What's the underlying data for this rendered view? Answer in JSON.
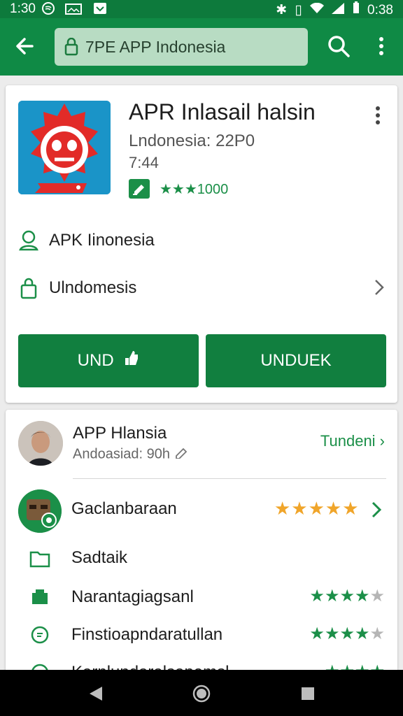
{
  "status_bar": {
    "time": "1:30",
    "right_time": "0:38",
    "icons": [
      "spotify-icon",
      "gallery-icon",
      "notification-icon"
    ]
  },
  "app_bar": {
    "search_text": "7PE  APP Indonesia"
  },
  "app": {
    "title": "APR Inlasail halsin",
    "subtitle": "Lndonesia: 22P0",
    "size": "7:44",
    "rating_text": "★★★1000"
  },
  "info_rows": [
    {
      "label": "APK Iinonesia"
    },
    {
      "label": "Ulndomesis"
    }
  ],
  "buttons": {
    "left": "UND",
    "right": "UNDUEK"
  },
  "developer": {
    "name": "APP Hlansia",
    "sub": "Andoasiad: 90h",
    "link": "Tundeni ›"
  },
  "game": {
    "name": "Gaclanbaraan",
    "stars": "★★★★★"
  },
  "list": [
    {
      "label": "Sadtaik",
      "stars": ""
    },
    {
      "label": "Narantagiagsanl",
      "stars": "★★★★"
    },
    {
      "label": "Finstioapndaratullan",
      "stars": "★★★★"
    },
    {
      "label": "Karnlundaralsapemsl",
      "stars": "★★★★"
    }
  ],
  "colors": {
    "primary_dark": "#0d7a3c",
    "primary": "#0f8a45",
    "button": "#117f3f",
    "star_orange": "#f0a52a"
  }
}
